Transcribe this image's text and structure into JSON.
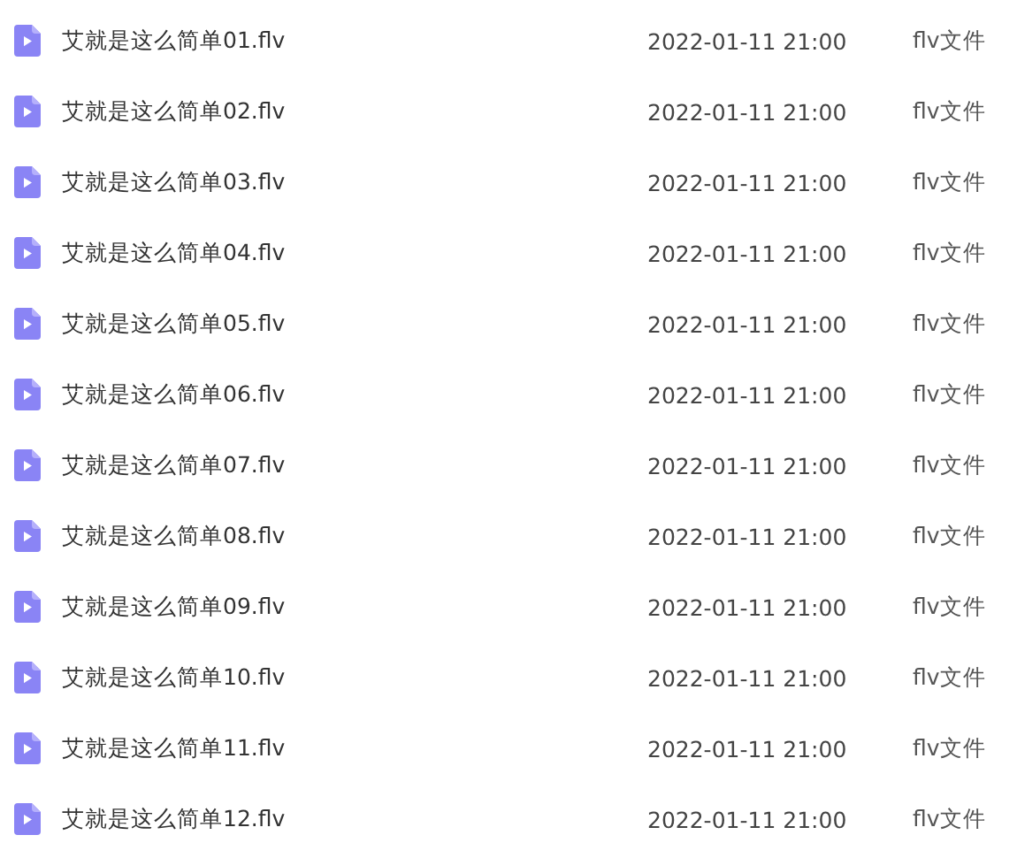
{
  "files": [
    {
      "name": "艾就是这么简单01.flv",
      "modified": "2022-01-11 21:00",
      "type": "flv文件"
    },
    {
      "name": "艾就是这么简单02.flv",
      "modified": "2022-01-11 21:00",
      "type": "flv文件"
    },
    {
      "name": "艾就是这么简单03.flv",
      "modified": "2022-01-11 21:00",
      "type": "flv文件"
    },
    {
      "name": "艾就是这么简单04.flv",
      "modified": "2022-01-11 21:00",
      "type": "flv文件"
    },
    {
      "name": "艾就是这么简单05.flv",
      "modified": "2022-01-11 21:00",
      "type": "flv文件"
    },
    {
      "name": "艾就是这么简单06.flv",
      "modified": "2022-01-11 21:00",
      "type": "flv文件"
    },
    {
      "name": "艾就是这么简单07.flv",
      "modified": "2022-01-11 21:00",
      "type": "flv文件"
    },
    {
      "name": "艾就是这么简单08.flv",
      "modified": "2022-01-11 21:00",
      "type": "flv文件"
    },
    {
      "name": "艾就是这么简单09.flv",
      "modified": "2022-01-11 21:00",
      "type": "flv文件"
    },
    {
      "name": "艾就是这么简单10.flv",
      "modified": "2022-01-11 21:00",
      "type": "flv文件"
    },
    {
      "name": "艾就是这么简单11.flv",
      "modified": "2022-01-11 21:00",
      "type": "flv文件"
    },
    {
      "name": "艾就是这么简单12.flv",
      "modified": "2022-01-11 21:00",
      "type": "flv文件"
    }
  ]
}
